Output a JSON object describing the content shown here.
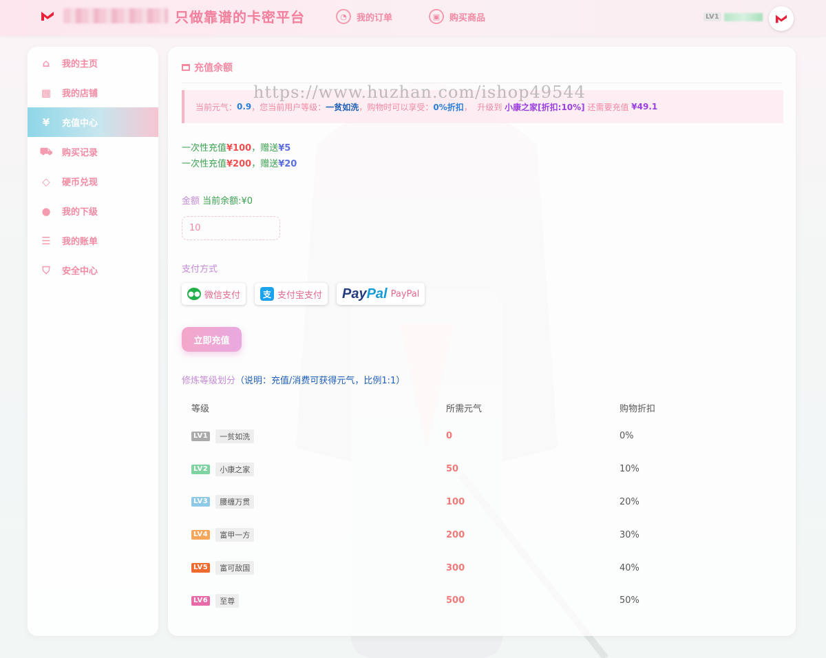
{
  "header": {
    "site_title": "只做靠谱的卡密平台",
    "nav": [
      {
        "label": "我的订单",
        "icon": "order-icon"
      },
      {
        "label": "购买商品",
        "icon": "shop-bag-icon"
      }
    ],
    "user_level_badge": "LV1"
  },
  "sidebar": {
    "items": [
      {
        "label": "我的主页",
        "icon": "home-icon"
      },
      {
        "label": "我的店铺",
        "icon": "store-icon"
      },
      {
        "label": "充值中心",
        "icon": "yen-icon",
        "active": true
      },
      {
        "label": "购买记录",
        "icon": "cart-icon"
      },
      {
        "label": "硬币兑现",
        "icon": "diamond-icon"
      },
      {
        "label": "我的下级",
        "icon": "user-icon"
      },
      {
        "label": "我的账单",
        "icon": "bill-icon"
      },
      {
        "label": "安全中心",
        "icon": "shield-icon"
      }
    ]
  },
  "main": {
    "title": "充值余额",
    "watermark": "https://www.huzhan.com/ishop49544",
    "notice": {
      "p1": "当前元气：",
      "qi": "0.9",
      "p2": "，您当前用户等级：",
      "level": "一贫如洗",
      "p3": "，购物时可以享受：",
      "discount": "0%折扣",
      "p4": "，  升级到 ",
      "next_level": "小康之家[折扣:10%]",
      "p5": " 还需要充值 ",
      "need": "¥49.1"
    },
    "offers": [
      {
        "prefix": "一次性充值",
        "amount": "¥100",
        "mid": "，赠送",
        "bonus": "¥5"
      },
      {
        "prefix": "一次性充值",
        "amount": "¥200",
        "mid": "，赠送",
        "bonus": "¥20"
      }
    ],
    "amount_label": "金额",
    "balance_label": "当前余额:¥0",
    "amount_value": "10",
    "pay_label": "支付方式",
    "pay_methods": {
      "wechat": "微信支付",
      "alipay": "支付宝支付",
      "paypal_logo_a": "Pay",
      "paypal_logo_b": "Pal",
      "paypal": "PayPal"
    },
    "submit_label": "立即充值",
    "level_title": "修炼等级划分",
    "level_note": "（说明：充值/消费可获得元气，比例1:1）",
    "table": {
      "headers": [
        "等级",
        "所需元气",
        "购物折扣"
      ],
      "rows": [
        {
          "tag": "LV1",
          "name": "一贫如洗",
          "qi": "0",
          "discount": "0%"
        },
        {
          "tag": "LV2",
          "name": "小康之家",
          "qi": "50",
          "discount": "10%"
        },
        {
          "tag": "LV3",
          "name": "腰缠万贯",
          "qi": "100",
          "discount": "20%"
        },
        {
          "tag": "LV4",
          "name": "富甲一方",
          "qi": "200",
          "discount": "30%"
        },
        {
          "tag": "LV5",
          "name": "富可敌国",
          "qi": "300",
          "discount": "40%"
        },
        {
          "tag": "LV6",
          "name": "至尊",
          "qi": "500",
          "discount": "50%"
        }
      ]
    }
  },
  "colors": {
    "accent_pink": "#f28aa3",
    "active_gradient_start": "#8fd6e8",
    "lv_tag_colors": [
      "#aaaaaa",
      "#7fd3a0",
      "#8ec9e8",
      "#f5a65b",
      "#f06a2e",
      "#e86aa8"
    ]
  }
}
